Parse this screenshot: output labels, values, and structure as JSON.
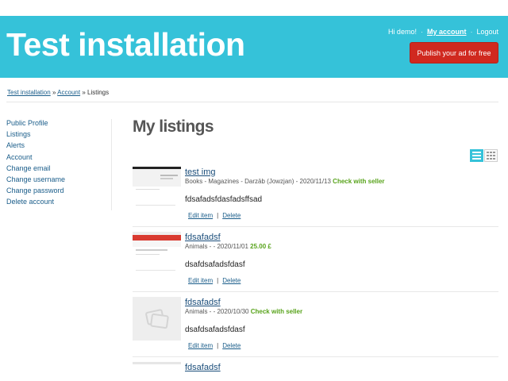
{
  "header": {
    "site_title": "Test installation",
    "greeting": "Hi demo!",
    "my_account": "My account",
    "logout": "Logout",
    "publish_button": "Publish your ad for free",
    "colors": {
      "background": "#35c2d9",
      "publish": "#d0291f"
    }
  },
  "breadcrumb": {
    "home": "Test installation",
    "account": "Account",
    "separator": "»",
    "current": "Listings"
  },
  "sidebar": {
    "items": [
      "Public Profile",
      "Listings",
      "Alerts",
      "Account",
      "Change email",
      "Change username",
      "Change password",
      "Delete account"
    ]
  },
  "main": {
    "title": "My listings",
    "view_toggle": {
      "active": "list",
      "icons": [
        "list-view-icon",
        "grid-view-icon"
      ]
    },
    "listings": [
      {
        "title": "test img",
        "meta": "Books - Magazines - Darzāb (Jowzjan) - 2020/11/13",
        "price": "Check with seller",
        "description": "fdsafadsfdasfadsffsad",
        "edit": "Edit item",
        "delete": "Delete",
        "thumbnail": "screenshot-thumbnail"
      },
      {
        "title": "fdsafadsf",
        "meta": "Animals - - 2020/11/01",
        "price": "25.00 £",
        "description": "dsafdsafadsfdasf",
        "edit": "Edit item",
        "delete": "Delete",
        "thumbnail": "screenshot-thumbnail"
      },
      {
        "title": "fdsafadsf",
        "meta": "Animals - - 2020/10/30",
        "price": "Check with seller",
        "description": "dsafdsafadsfdasf",
        "edit": "Edit item",
        "delete": "Delete",
        "thumbnail": "placeholder-image-icon"
      },
      {
        "title": "fdsafadsf",
        "thumbnail": "screenshot-thumbnail"
      }
    ]
  }
}
